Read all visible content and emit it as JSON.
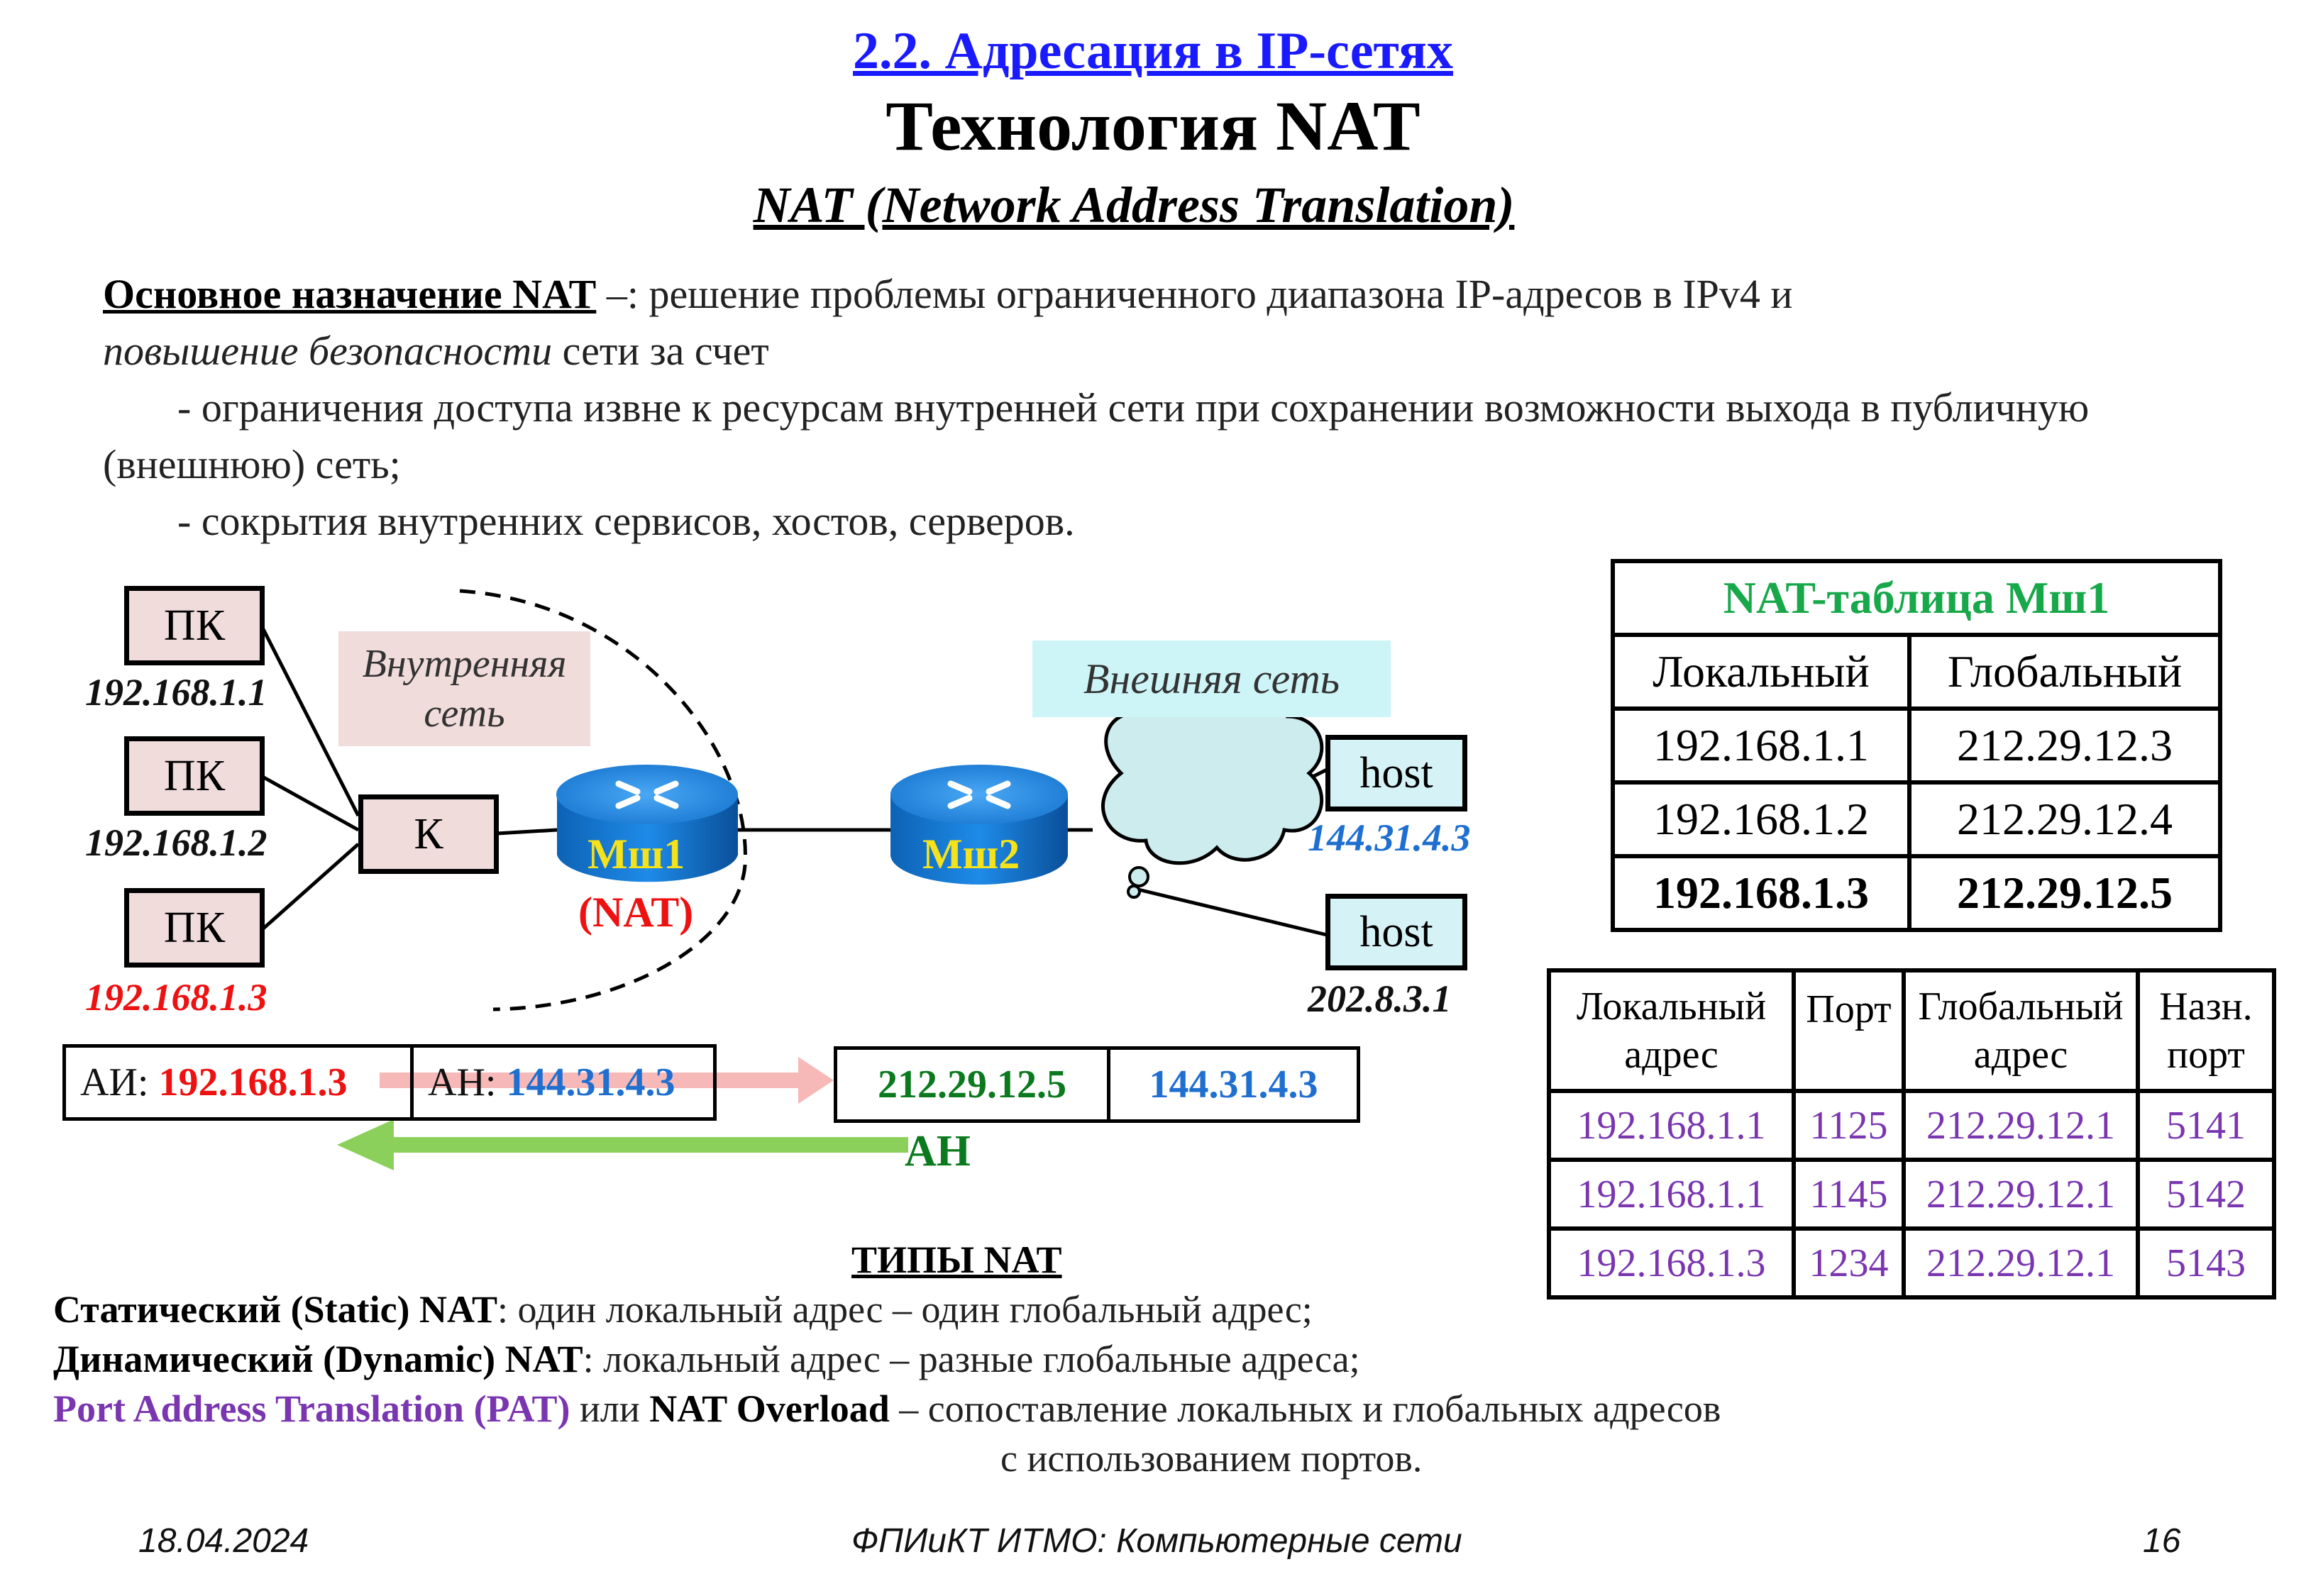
{
  "header": {
    "section": "2.2. Адресация в IP-сетях",
    "title": "Технология NAT",
    "subtitle": "NAT (Network Address Translation)"
  },
  "intro": {
    "lead": "Основное назначение NAT",
    "lead_rest": " –: решение проблемы ограниченного диапазона IP-адресов в IPv4 и",
    "italic": "повышение безопасности",
    "italic_rest": " сети за счет",
    "bullet1": "- ограничения доступа извне к ресурсам внутренней сети при сохранении возможности выхода в публичную (внешнюю) сеть;",
    "bullet2": "- сокрытия внутренних сервисов, хостов, серверов."
  },
  "diagram": {
    "pc_label": "ПК",
    "pc1_ip": "192.168.1.1",
    "pc2_ip": "192.168.1.2",
    "pc3_ip": "192.168.1.3",
    "switch_label": "К",
    "internal_net": "Внутренняя сеть",
    "external_net": "Внешняя сеть",
    "router1": "Мш1",
    "router1_note": "(NAT)",
    "router2": "Мш2",
    "host_label": "host",
    "host1_ip": "144.31.4.3",
    "host2_ip": "202.8.3.1",
    "packet_in_src_prefix": "АИ: ",
    "packet_in_src": "192.168.1.3",
    "packet_in_dst_prefix": "АН: ",
    "packet_in_dst": "144.31.4.3",
    "packet_out_src": "212.29.12.5",
    "packet_out_dst": "144.31.4.3",
    "return_label": "АН"
  },
  "nat_table": {
    "title": "NAT-таблица Мш1",
    "headers": [
      "Локальный",
      "Глобальный"
    ],
    "rows": [
      [
        "192.168.1.1",
        "212.29.12.3"
      ],
      [
        "192.168.1.2",
        "212.29.12.4"
      ],
      [
        "192.168.1.3",
        "212.29.12.5"
      ]
    ]
  },
  "pat_table": {
    "headers": [
      "Локальный адрес",
      "Порт",
      "Глобальный адрес",
      "Назн. порт"
    ],
    "rows": [
      [
        "192.168.1.1",
        "1125",
        "212.29.12.1",
        "5141"
      ],
      [
        "192.168.1.1",
        "1145",
        "212.29.12.1",
        "5142"
      ],
      [
        "192.168.1.3",
        "1234",
        "212.29.12.1",
        "5143"
      ]
    ]
  },
  "types": {
    "heading": "ТИПЫ NAT",
    "static_name": "Статический (Static) NAT",
    "static_desc": ":  один локальный адрес – один глобальный адрес;",
    "dynamic_name": "Динамический (Dynamic) NAT",
    "dynamic_desc": ":  локальный адрес – разные глобальные адреса;",
    "pat_name": "Port Address Translation (PAT)",
    "pat_or": " или ",
    "pat_overload": "NAT Overload",
    "pat_desc": " – сопоставление локальных и глобальных адресов",
    "pat_desc2": "с использованием портов."
  },
  "footer": {
    "date": "18.04.2024",
    "course": "ФПИиКТ ИТМО: Компьютерные сети",
    "page": "16"
  },
  "colors": {
    "section_link": "#1a1aff",
    "red": "#ee1111",
    "blue": "#1f6fd0",
    "green": "#0b7a1e",
    "nat_title": "#17a84a",
    "purple": "#7a35b0"
  }
}
